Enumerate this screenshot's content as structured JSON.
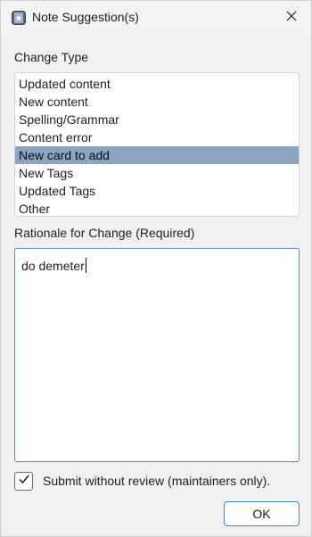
{
  "window": {
    "title": "Note Suggestion(s)"
  },
  "change_type": {
    "label": "Change Type",
    "options": [
      "Updated content",
      "New content",
      "Spelling/Grammar",
      "Content error",
      "New card to add",
      "New Tags",
      "Updated Tags",
      "Other"
    ],
    "selected": "New card to add"
  },
  "rationale": {
    "label": "Rationale for Change (Required)",
    "value": "do demeter"
  },
  "submit_without_review": {
    "label": "Submit without review (maintainers only).",
    "checked": true
  },
  "buttons": {
    "ok_label": "OK"
  },
  "colors": {
    "selection": "#8aa4c2",
    "focus_border": "#5c8fd1"
  },
  "icons": [
    "app-icon",
    "close-icon",
    "checkmark-icon"
  ]
}
